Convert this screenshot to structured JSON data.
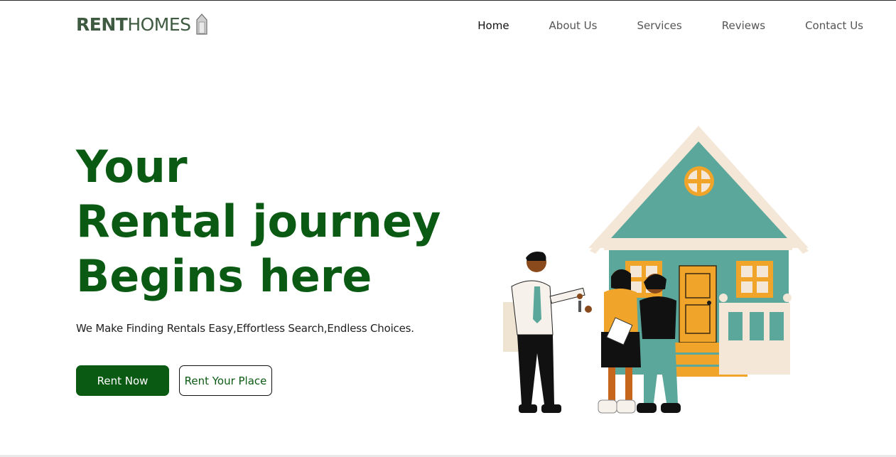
{
  "brand": {
    "name_bold": "RENT",
    "name_light": "HOMES"
  },
  "nav": {
    "items": [
      {
        "label": "Home",
        "active": true
      },
      {
        "label": "About Us",
        "active": false
      },
      {
        "label": "Services",
        "active": false
      },
      {
        "label": "Reviews",
        "active": false
      },
      {
        "label": "Contact Us",
        "active": false
      }
    ]
  },
  "hero": {
    "title_lines": [
      "Your",
      "Rental journey",
      "Begins here"
    ],
    "tagline": "We Make Finding Rentals Easy,Effortless Search,Endless Choices.",
    "primary_button": "Rent Now",
    "secondary_button": "Rent Your Place"
  },
  "illustration": {
    "icon": "house-handover-illustration"
  },
  "colors": {
    "brand_green": "#0b5a14",
    "logo_green": "#3e5a40",
    "house_teal": "#5ba79b",
    "house_roof_trim": "#f4e7d8",
    "accent_orange": "#f0a42a"
  }
}
